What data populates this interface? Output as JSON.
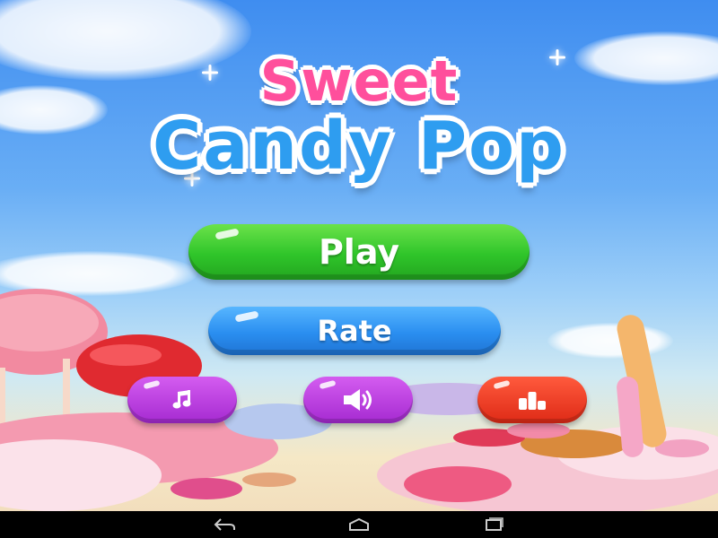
{
  "game": {
    "title_line1": "Sweet",
    "title_line2": "Candy Pop"
  },
  "menu": {
    "play_label": "Play",
    "rate_label": "Rate"
  },
  "icons": {
    "music": "music-note-icon",
    "sound": "speaker-icon",
    "leaderboard": "leaderboard-icon"
  },
  "navigation": {
    "back": "back-icon",
    "home": "home-icon",
    "recents": "recents-icon"
  },
  "colors": {
    "play_button": "#2fc52a",
    "rate_button": "#2a8ef0",
    "music_button": "#a52ad1",
    "sound_button": "#a52ad1",
    "leaderboard_button": "#de2a16",
    "title_pink": "#ff4f9c",
    "title_blue": "#2e9df0"
  }
}
